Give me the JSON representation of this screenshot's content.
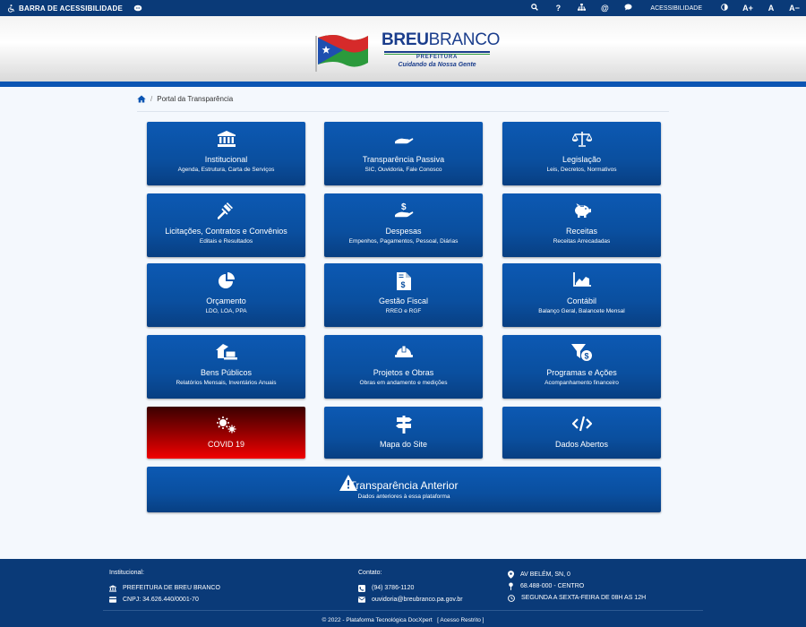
{
  "topbar": {
    "accessibility_bar": "BARRA DE ACESSIBILIDADE",
    "accessibility_label": "ACESSIBILIDADE",
    "font_increase": "A+",
    "font_reset": "A",
    "font_decrease": "A−"
  },
  "header": {
    "logo_brand_bold": "BREU",
    "logo_brand_light": "BRANCO",
    "logo_sub": "PREFEITURA",
    "logo_slogan": "Cuidando da Nossa Gente"
  },
  "breadcrumb": {
    "current": "Portal da Transparência"
  },
  "cards": [
    {
      "title": "Institucional",
      "subtitle": "Agenda, Estrutura, Carta de Serviços",
      "icon": "institution-icon"
    },
    {
      "title": "Transparência Passiva",
      "subtitle": "SIC, Ouvidoria, Fale Conosco",
      "icon": "hand-icon"
    },
    {
      "title": "Legislação",
      "subtitle": "Leis, Decretos, Normativos",
      "icon": "balance-scale-icon"
    },
    {
      "title": "Licitações, Contratos e Convênios",
      "subtitle": "Editais e Resultados",
      "icon": "gavel-icon"
    },
    {
      "title": "Despesas",
      "subtitle": "Empenhos, Pagamentos, Pessoal, Diárias",
      "icon": "hand-dollar-icon"
    },
    {
      "title": "Receitas",
      "subtitle": "Receitas Arrecadadas",
      "icon": "piggy-bank-icon"
    },
    {
      "title": "Orçamento",
      "subtitle": "LDO, LOA, PPA",
      "icon": "pie-chart-icon"
    },
    {
      "title": "Gestão Fiscal",
      "subtitle": "RREO e RGF",
      "icon": "invoice-dollar-icon"
    },
    {
      "title": "Contábil",
      "subtitle": "Balanço Geral, Balancete Mensal",
      "icon": "area-chart-icon"
    },
    {
      "title": "Bens Públicos",
      "subtitle": "Relatórios Mensais, Inventários Anuais",
      "icon": "house-laptop-icon"
    },
    {
      "title": "Projetos e Obras",
      "subtitle": "Obras em andamento e medições",
      "icon": "hard-hat-icon"
    },
    {
      "title": "Programas e Ações",
      "subtitle": "Acompanhamento financeiro",
      "icon": "funnel-dollar-icon"
    },
    {
      "title": "COVID 19",
      "icon": "virus-icon"
    },
    {
      "title": "Mapa do Site",
      "icon": "signpost-icon"
    },
    {
      "title": "Dados Abertos",
      "icon": "code-icon"
    }
  ],
  "previous": {
    "title": "Transparência Anterior",
    "subtitle": "Dados anteriores à essa plataforma",
    "icon": "warning-icon"
  },
  "footer": {
    "institucional_label": "Institucional:",
    "org_name": "PREFEITURA DE BREU BRANCO",
    "cnpj": "CNPJ: 34.626.440/0001-70",
    "contato_label": "Contato:",
    "phone": "(94) 3786-1120",
    "email": "ouvidoria@breubranco.pa.gov.br",
    "address": "AV BELÉM, SN, 0",
    "cep": "68.488-000 - CENTRO",
    "hours": "SEGUNDA A SEXTA-FEIRA DE 08H AS 12H",
    "copyright": "© 2022 - Plataforma Tecnológica DocXpert",
    "restricted": "[ Acesso Restrito ]"
  },
  "colors": {
    "primary": "#0a4f9f",
    "dark_navy": "#0a3a78",
    "accent_bar": "#0b55b3",
    "covid_red": "#f20000"
  }
}
